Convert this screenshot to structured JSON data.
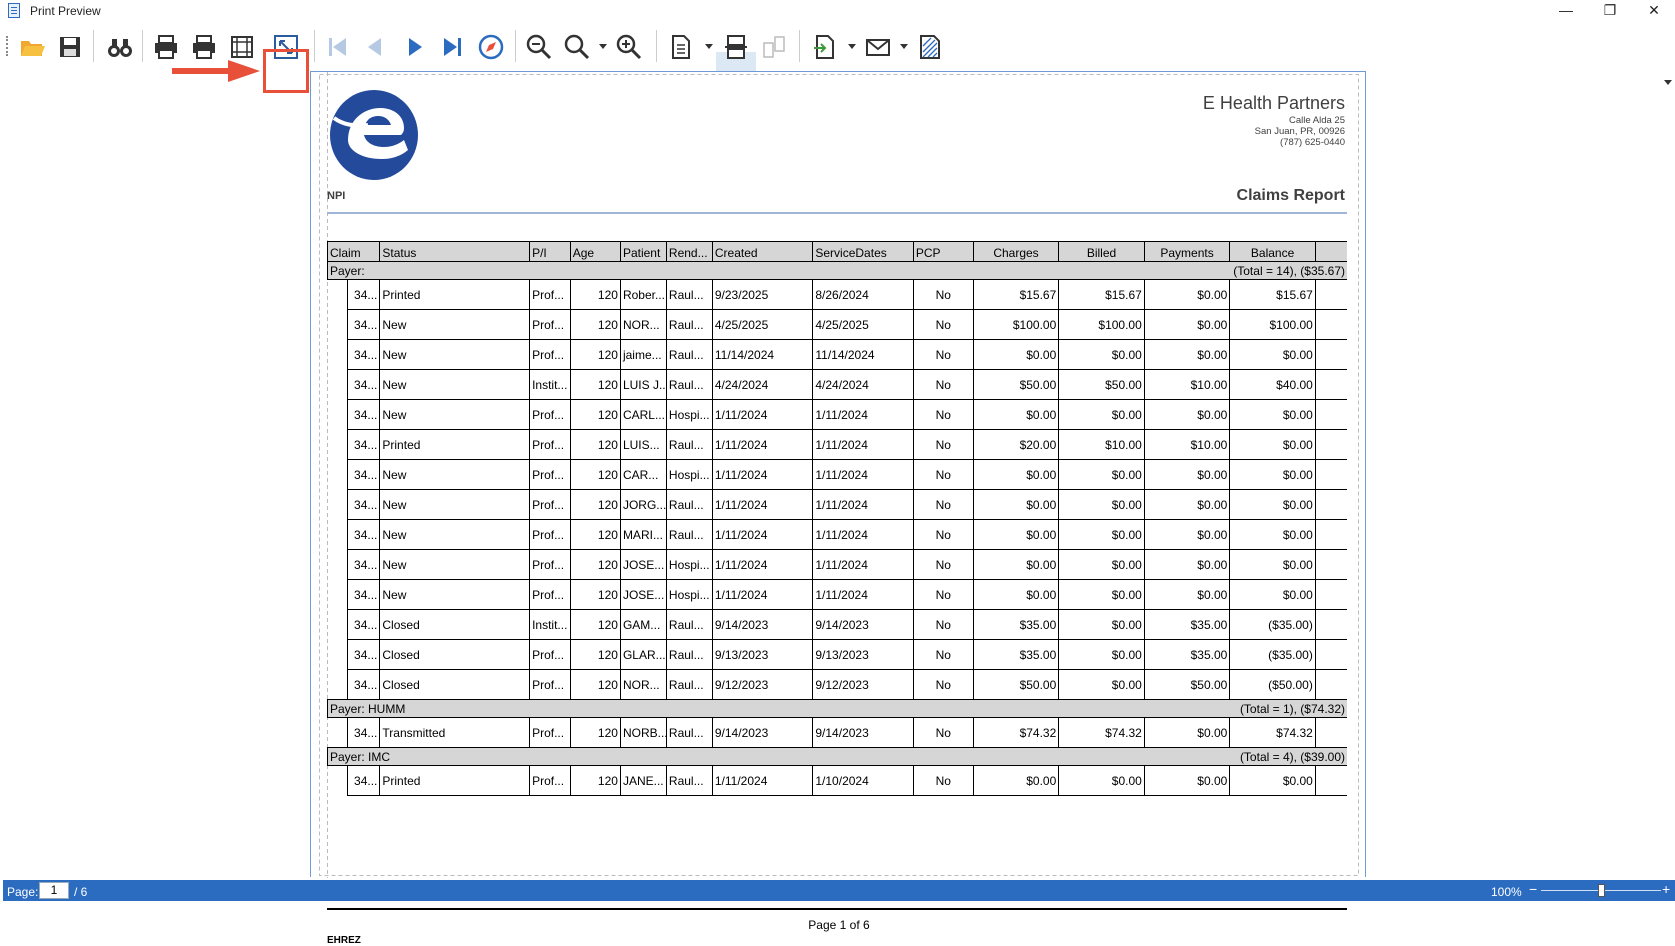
{
  "window": {
    "title": "Print Preview",
    "minimize_icon": "minimize-icon",
    "restore_icon": "restore-icon",
    "close_icon": "close-icon"
  },
  "toolbar": {
    "highlighted": "zoom-to-page-icon",
    "annotation_arrow_color": "#e8503a"
  },
  "report": {
    "company": "E Health Partners",
    "address": [
      "Calle Alda 25",
      "San Juan, PR, 00926",
      "(787) 625-0440"
    ],
    "npi_label": "NPI",
    "title": "Claims Report",
    "columns": [
      "Claim",
      "Status",
      "P/I",
      "Age",
      "Patient",
      "Rend...",
      "Created",
      "ServiceDates",
      "PCP",
      "Charges",
      "Billed",
      "Payments",
      "Balance"
    ],
    "groups": [
      {
        "label": "Payer:",
        "summary": "(Total = 14), ($35.67)",
        "rows": [
          {
            "claim": "34...",
            "status": "Printed",
            "pi": "Prof...",
            "age": "120",
            "patient": "Rober...",
            "rend": "Raul...",
            "created": "9/23/2025",
            "service": "8/26/2024",
            "pcp": "No",
            "charges": "$15.67",
            "billed": "$15.67",
            "payments": "$0.00",
            "balance": "$15.67"
          },
          {
            "claim": "34...",
            "status": "New",
            "pi": "Prof...",
            "age": "120",
            "patient": "NOR...",
            "rend": "Raul...",
            "created": "4/25/2025",
            "service": "4/25/2025",
            "pcp": "No",
            "charges": "$100.00",
            "billed": "$100.00",
            "payments": "$0.00",
            "balance": "$100.00"
          },
          {
            "claim": "34...",
            "status": "New",
            "pi": "Prof...",
            "age": "120",
            "patient": "jaime...",
            "rend": "Raul...",
            "created": "11/14/2024",
            "service": "11/14/2024",
            "pcp": "No",
            "charges": "$0.00",
            "billed": "$0.00",
            "payments": "$0.00",
            "balance": "$0.00"
          },
          {
            "claim": "34...",
            "status": "New",
            "pi": "Instit...",
            "age": "120",
            "patient": "LUIS J...",
            "rend": "Raul...",
            "created": "4/24/2024",
            "service": "4/24/2024",
            "pcp": "No",
            "charges": "$50.00",
            "billed": "$50.00",
            "payments": "$10.00",
            "balance": "$40.00"
          },
          {
            "claim": "34...",
            "status": "New",
            "pi": "Prof...",
            "age": "120",
            "patient": "CARL...",
            "rend": "Hospi...",
            "created": "1/11/2024",
            "service": "1/11/2024",
            "pcp": "No",
            "charges": "$0.00",
            "billed": "$0.00",
            "payments": "$0.00",
            "balance": "$0.00"
          },
          {
            "claim": "34...",
            "status": "Printed",
            "pi": "Prof...",
            "age": "120",
            "patient": "LUIS...",
            "rend": "Raul...",
            "created": "1/11/2024",
            "service": "1/11/2024",
            "pcp": "No",
            "charges": "$20.00",
            "billed": "$10.00",
            "payments": "$10.00",
            "balance": "$0.00"
          },
          {
            "claim": "34...",
            "status": "New",
            "pi": "Prof...",
            "age": "120",
            "patient": "CAR...",
            "rend": "Hospi...",
            "created": "1/11/2024",
            "service": "1/11/2024",
            "pcp": "No",
            "charges": "$0.00",
            "billed": "$0.00",
            "payments": "$0.00",
            "balance": "$0.00"
          },
          {
            "claim": "34...",
            "status": "New",
            "pi": "Prof...",
            "age": "120",
            "patient": "JORG...",
            "rend": "Raul...",
            "created": "1/11/2024",
            "service": "1/11/2024",
            "pcp": "No",
            "charges": "$0.00",
            "billed": "$0.00",
            "payments": "$0.00",
            "balance": "$0.00"
          },
          {
            "claim": "34...",
            "status": "New",
            "pi": "Prof...",
            "age": "120",
            "patient": "MARI...",
            "rend": "Raul...",
            "created": "1/11/2024",
            "service": "1/11/2024",
            "pcp": "No",
            "charges": "$0.00",
            "billed": "$0.00",
            "payments": "$0.00",
            "balance": "$0.00"
          },
          {
            "claim": "34...",
            "status": "New",
            "pi": "Prof...",
            "age": "120",
            "patient": "JOSE...",
            "rend": "Hospi...",
            "created": "1/11/2024",
            "service": "1/11/2024",
            "pcp": "No",
            "charges": "$0.00",
            "billed": "$0.00",
            "payments": "$0.00",
            "balance": "$0.00"
          },
          {
            "claim": "34...",
            "status": "New",
            "pi": "Prof...",
            "age": "120",
            "patient": "JOSE...",
            "rend": "Hospi...",
            "created": "1/11/2024",
            "service": "1/11/2024",
            "pcp": "No",
            "charges": "$0.00",
            "billed": "$0.00",
            "payments": "$0.00",
            "balance": "$0.00"
          },
          {
            "claim": "34...",
            "status": "Closed",
            "pi": "Instit...",
            "age": "120",
            "patient": "GAM...",
            "rend": "Raul...",
            "created": "9/14/2023",
            "service": "9/14/2023",
            "pcp": "No",
            "charges": "$35.00",
            "billed": "$0.00",
            "payments": "$35.00",
            "balance": "($35.00)"
          },
          {
            "claim": "34...",
            "status": "Closed",
            "pi": "Prof...",
            "age": "120",
            "patient": "GLAR...",
            "rend": "Raul...",
            "created": "9/13/2023",
            "service": "9/13/2023",
            "pcp": "No",
            "charges": "$35.00",
            "billed": "$0.00",
            "payments": "$35.00",
            "balance": "($35.00)"
          },
          {
            "claim": "34...",
            "status": "Closed",
            "pi": "Prof...",
            "age": "120",
            "patient": "NOR...",
            "rend": "Raul...",
            "created": "9/12/2023",
            "service": "9/12/2023",
            "pcp": "No",
            "charges": "$50.00",
            "billed": "$0.00",
            "payments": "$50.00",
            "balance": "($50.00)"
          }
        ]
      },
      {
        "label": "Payer: HUMM",
        "summary": "(Total = 1), ($74.32)",
        "rows": [
          {
            "claim": "34...",
            "status": "Transmitted",
            "pi": "Prof...",
            "age": "120",
            "patient": "NORB...",
            "rend": "Raul...",
            "created": "9/14/2023",
            "service": "9/14/2023",
            "pcp": "No",
            "charges": "$74.32",
            "billed": "$74.32",
            "payments": "$0.00",
            "balance": "$74.32"
          }
        ]
      },
      {
        "label": "Payer: IMC",
        "summary": "(Total = 4), ($39.00)",
        "rows": [
          {
            "claim": "34...",
            "status": "Printed",
            "pi": "Prof...",
            "age": "120",
            "patient": "JANE...",
            "rend": "Raul...",
            "created": "1/11/2024",
            "service": "1/10/2024",
            "pcp": "No",
            "charges": "$0.00",
            "billed": "$0.00",
            "payments": "$0.00",
            "balance": "$0.00"
          }
        ]
      }
    ],
    "page_text": "Page 1 of 6",
    "user": "EHREZ"
  },
  "status": {
    "page_label": "Page:",
    "page_value": "1",
    "page_total": "/ 6",
    "zoom": "100%",
    "zoom_minus": "−",
    "zoom_plus": "+",
    "zoom_fraction": 0.5,
    "bar_color": "#2b6cc0"
  }
}
